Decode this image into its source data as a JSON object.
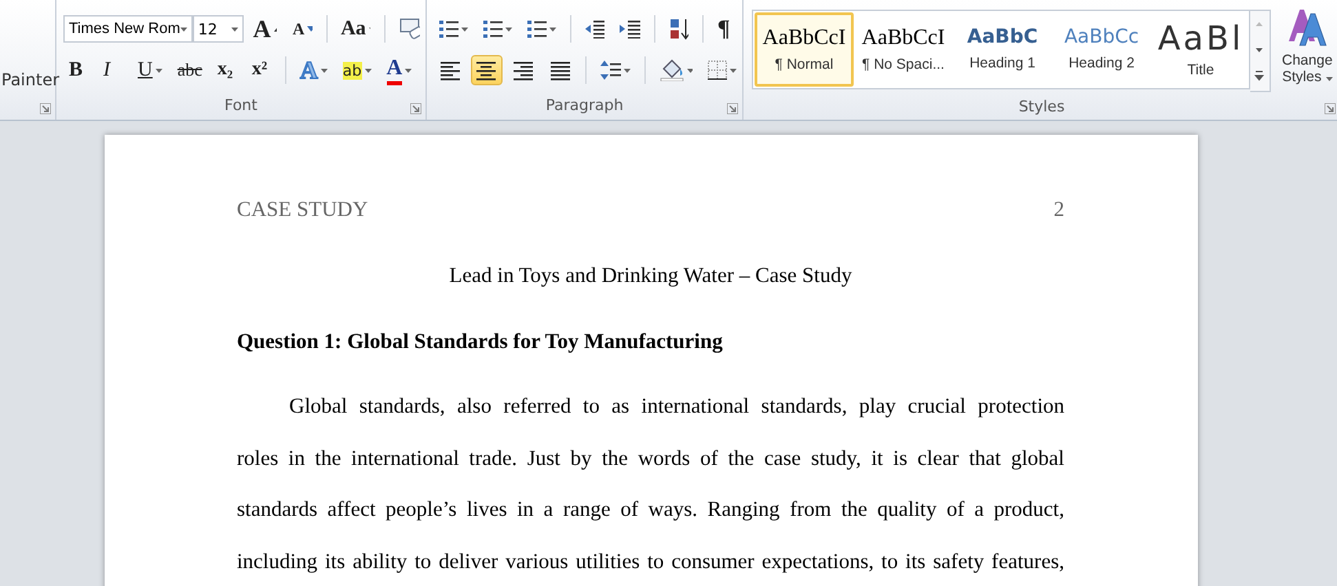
{
  "clipboard": {
    "partial_label": "Painter"
  },
  "font": {
    "name": "Times New Rom",
    "size": "12",
    "label": "Font",
    "row1": [
      {
        "kind": "grow",
        "glyph": "A"
      },
      {
        "kind": "shrink",
        "glyph": "A"
      },
      {
        "kind": "case",
        "glyph": "Aa"
      }
    ],
    "row2": [
      {
        "kind": "bold",
        "glyph": "B"
      },
      {
        "kind": "italic",
        "glyph": "I"
      },
      {
        "kind": "underline",
        "glyph": "U"
      },
      {
        "kind": "strike",
        "glyph": "abc"
      },
      {
        "kind": "sub",
        "glyph": "x₂"
      },
      {
        "kind": "sup",
        "glyph": "x²"
      },
      {
        "kind": "effects",
        "glyph": "A"
      },
      {
        "kind": "highlight",
        "glyph": "ab"
      },
      {
        "kind": "color",
        "glyph": "A"
      }
    ]
  },
  "paragraph": {
    "label": "Paragraph",
    "pilcrow": "¶",
    "alignments": [
      {
        "kind": "left",
        "selected": false
      },
      {
        "kind": "center",
        "selected": true
      },
      {
        "kind": "right",
        "selected": false
      },
      {
        "kind": "justify",
        "selected": false
      }
    ]
  },
  "styles": {
    "label": "Styles",
    "change_styles": "Change Styles",
    "items": [
      {
        "kind": "normal",
        "preview": "AaBbCcI",
        "name": "¶ Normal",
        "selected": true
      },
      {
        "kind": "no-spacing",
        "preview": "AaBbCcI",
        "name": "¶ No Spaci...",
        "selected": false
      },
      {
        "kind": "heading1",
        "preview": "AaBbC",
        "name": "Heading 1",
        "selected": false
      },
      {
        "kind": "heading2",
        "preview": "AaBbCc",
        "name": "Heading 2",
        "selected": false
      },
      {
        "kind": "title",
        "preview": "AaBl",
        "name": "Title",
        "selected": false
      }
    ]
  },
  "document": {
    "header": "CASE STUDY",
    "page_number": "2",
    "title": "Lead in Toys and Drinking Water – Case Study",
    "heading": "Question 1: Global Standards for Toy Manufacturing",
    "paragraph_lines": [
      "Global standards, also referred to as international standards, play crucial protection",
      "roles in the international trade. Just by the words of the case study, it is clear that global",
      "standards affect people’s lives in a range of ways. Ranging from the quality of a product,",
      "including its ability to deliver various utilities to consumer expectations, to its safety features,"
    ]
  }
}
